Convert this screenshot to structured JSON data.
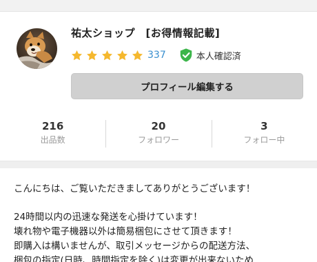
{
  "profile": {
    "shop_name": "祐太ショップ　[お得情報記載]",
    "rating_stars": 5,
    "review_count": "337",
    "verified_label": "本人確認済",
    "edit_button_label": "プロフィール編集する"
  },
  "stats": [
    {
      "value": "216",
      "label": "出品数"
    },
    {
      "value": "20",
      "label": "フォロワー"
    },
    {
      "value": "3",
      "label": "フォロー中"
    }
  ],
  "bio": {
    "greeting": "こんにちは、ご覧いただきましてありがとうございます！",
    "lines": [
      "24時間以内の迅速な発送を心掛けています！",
      "壊れ物や電子機器以外は簡易梱包にさせて頂きます！",
      "即購入は構いませんが、取引メッセージからの配送方法、",
      "梱包の指定(日時、時間指定を除く)は変更が出来ないため"
    ]
  },
  "colors": {
    "star": "#f5b82e",
    "link": "#3a8fcf",
    "verified": "#3cb54a",
    "button_bg": "#d0d0d0"
  },
  "icons": {
    "avatar": "shiba-dog-avatar",
    "star": "star-icon",
    "verified": "shield-check-icon"
  }
}
